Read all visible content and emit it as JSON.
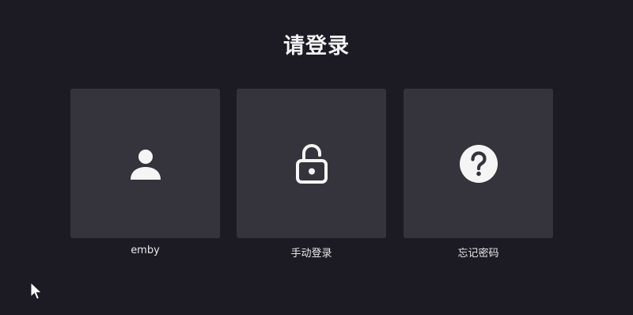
{
  "header": {
    "title": "请登录"
  },
  "users": [
    {
      "label": "emby",
      "icon": "user-icon"
    },
    {
      "label": "手动登录",
      "icon": "unlock-icon"
    },
    {
      "label": "忘记密码",
      "icon": "help-icon"
    }
  ],
  "colors": {
    "background": "#1c1a22",
    "tile": "#35333c",
    "text": "#e9e9ec"
  }
}
